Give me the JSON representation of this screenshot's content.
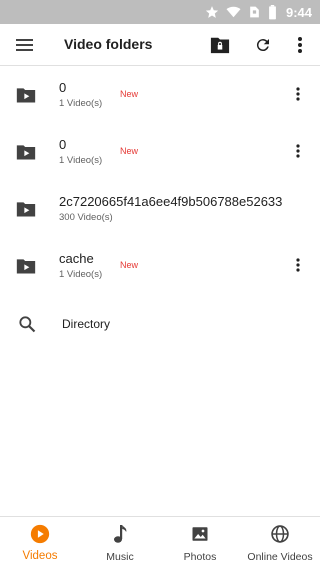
{
  "status_bar": {
    "time": "9:44"
  },
  "app_bar": {
    "title": "Video folders"
  },
  "folders": [
    {
      "name": "0",
      "count": "1 Video(s)",
      "badge": "New",
      "has_menu": true
    },
    {
      "name": "0",
      "count": "1 Video(s)",
      "badge": "New",
      "has_menu": true
    },
    {
      "name": "2c7220665f41a6ee4f9b506788e52633",
      "count": "300 Video(s)",
      "badge": "",
      "has_menu": false
    },
    {
      "name": "cache",
      "count": "1 Video(s)",
      "badge": "New",
      "has_menu": true
    }
  ],
  "search_item": {
    "label": "Directory"
  },
  "bottom_nav": {
    "items": [
      {
        "label": "Videos",
        "icon": "play-circle-icon",
        "active": true
      },
      {
        "label": "Music",
        "icon": "music-note-icon",
        "active": false
      },
      {
        "label": "Photos",
        "icon": "image-icon",
        "active": false
      },
      {
        "label": "Online Videos",
        "icon": "globe-icon",
        "active": false
      }
    ]
  },
  "colors": {
    "accent": "#f57c00",
    "badge": "#e53935",
    "status_bar": "#bdbdbd",
    "icon": "#424242"
  }
}
